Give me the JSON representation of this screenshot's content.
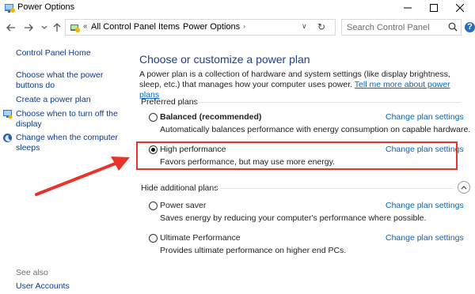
{
  "window": {
    "title": "Power Options"
  },
  "address": {
    "chevron": "«",
    "segment1": "All Control Panel Items",
    "segment2": "Power Options"
  },
  "search": {
    "placeholder": "Search Control Panel"
  },
  "left_pane": {
    "home": "Control Panel Home",
    "items": [
      {
        "label": "Choose what the power buttons do",
        "icon": null
      },
      {
        "label": "Create a power plan",
        "icon": null
      },
      {
        "label": "Choose when to turn off the display",
        "icon": "display-icon"
      },
      {
        "label": "Change when the computer sleeps",
        "icon": "sleep-icon"
      }
    ],
    "see_also": "See also",
    "user_accounts": "User Accounts"
  },
  "main": {
    "heading": "Choose or customize a power plan",
    "description": "A power plan is a collection of hardware and system settings (like display brightness, sleep, etc.) that manages how your computer uses power.",
    "description_link": "Tell me more about power plans",
    "preferred_label": "Preferred plans",
    "hide_label": "Hide additional plans",
    "change_link": "Change plan settings",
    "plans": [
      {
        "name": "Balanced (recommended)",
        "desc": "Automatically balances performance with energy consumption on capable hardware.",
        "selected": false,
        "bold": true
      },
      {
        "name": "High performance",
        "desc": "Favors performance, but may use more energy.",
        "selected": true,
        "bold": false
      },
      {
        "name": "Power saver",
        "desc": "Saves energy by reducing your computer's performance where possible.",
        "selected": false,
        "bold": false
      },
      {
        "name": "Ultimate Performance",
        "desc": "Provides ultimate performance on higher end PCs.",
        "selected": false,
        "bold": false
      }
    ]
  },
  "colors": {
    "heading": "#1f3f8f",
    "link": "#0066cc",
    "annotation": "#e8332a"
  }
}
